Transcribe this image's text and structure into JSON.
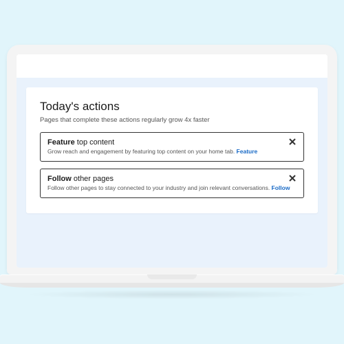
{
  "card": {
    "title": "Today's actions",
    "subtitle": "Pages that complete these actions regularly grow 4x faster"
  },
  "actions": [
    {
      "title_prefix": "Feature ",
      "title_rest": "top content",
      "description": "Grow reach and engagement by featuring top content on your home tab. ",
      "link_label": "Feature"
    },
    {
      "title_prefix": "Follow ",
      "title_rest": "other pages",
      "description": "Follow other pages to stay connected to your industry and join relevant conversations. ",
      "link_label": "Follow"
    }
  ]
}
